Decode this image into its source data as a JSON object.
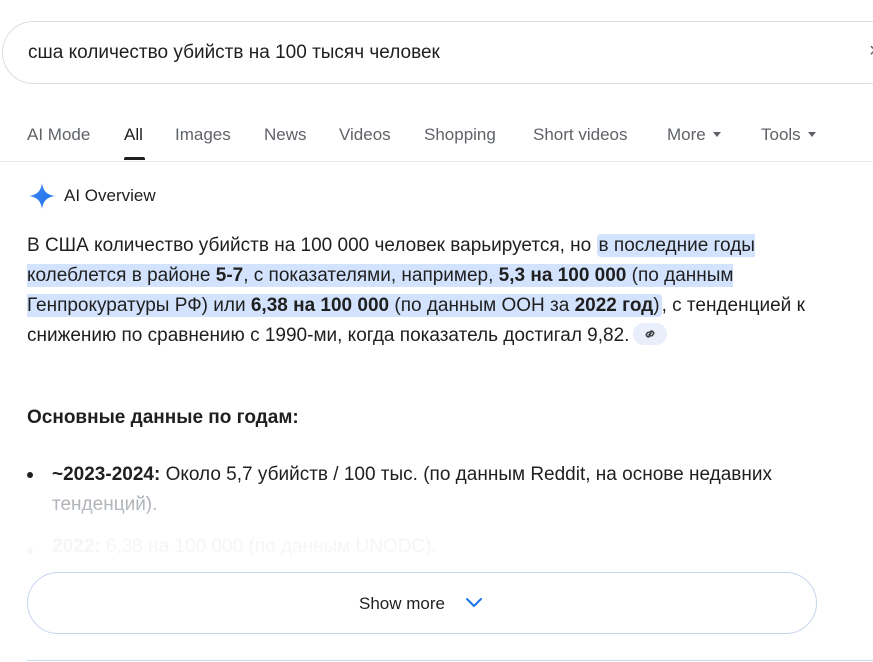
{
  "search": {
    "query": "сша количество убийств на 100 тысяч человек",
    "clear_glyph": "×"
  },
  "tabs": [
    {
      "label": "AI Mode"
    },
    {
      "label": "All"
    },
    {
      "label": "Images"
    },
    {
      "label": "News"
    },
    {
      "label": "Videos"
    },
    {
      "label": "Shopping"
    },
    {
      "label": "Short videos"
    },
    {
      "label": "More"
    },
    {
      "label": "Tools"
    }
  ],
  "ai_overview": {
    "title": "AI Overview",
    "accent_color": "#4285f4",
    "highlight_color": "#d3e3fd",
    "para": {
      "t1": "В США количество убийств на 100 000 человек варьируется, но ",
      "h1": "в последние годы колеблется в районе ",
      "b1": "5-7",
      "h2": ", с показателями, например, ",
      "b2": "5,3 на 100 000",
      "h3": " (по данным Генпрокуратуры РФ) или ",
      "b3": "6,38 на 100 000",
      "h4": " (по данным ООН за ",
      "b4": "2022 год",
      "h5": ")",
      "t2": ", с тенденцией к снижению по сравнению с 1990-ми, когда показатель достигал 9,82."
    },
    "cite_icon": "link-icon",
    "section_title": "Основные данные по годам:",
    "bullets": [
      {
        "bold": "~2023-2024:",
        "text": " Около 5,7 убийств / 100 тыс. (по данным Reddit, на основе недавних",
        "text_cont": "тенденций)."
      },
      {
        "bold": "2022:",
        "text": " 6,38 на 100 000 (по данным UNODC)."
      }
    ],
    "show_more_label": "Show more",
    "show_more_icon": "chevron-down-icon"
  }
}
